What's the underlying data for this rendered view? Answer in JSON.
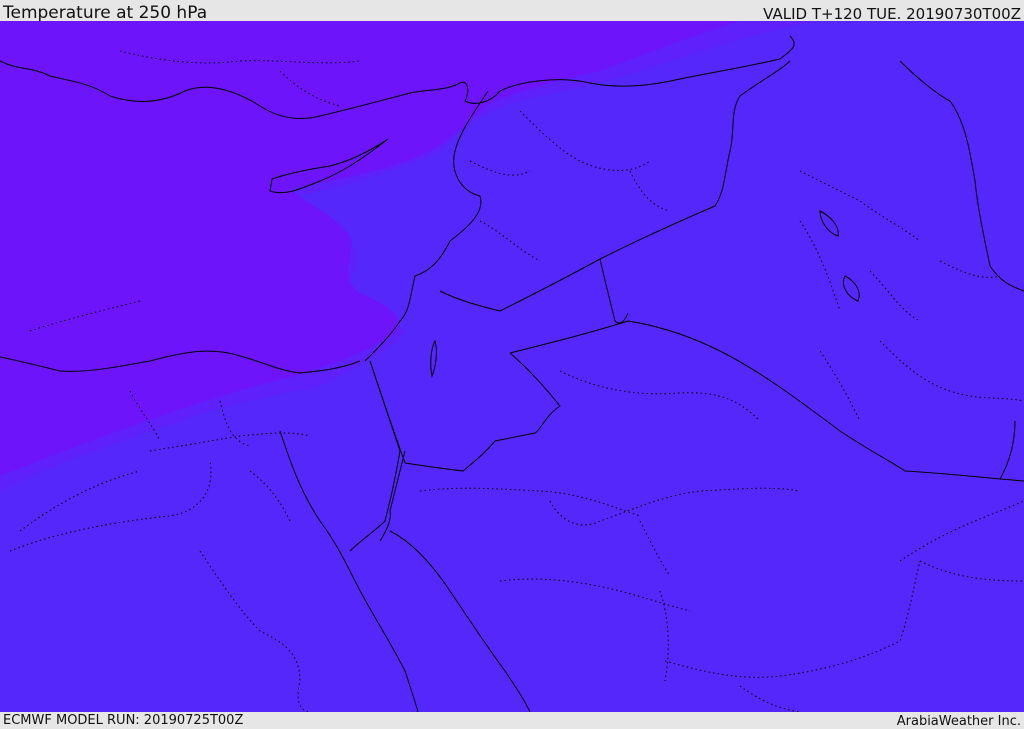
{
  "header": {
    "title": "Temperature at 250 hPa",
    "valid_time": "VALID T+120 TUE. 20190730T00Z"
  },
  "footer": {
    "model_run": "ECMWF MODEL RUN: 20190725T00Z",
    "credit": "ArabiaWeather Inc."
  },
  "colors": {
    "background_bar": "#e6e6e6",
    "warm_zone": "#5627fb",
    "cool_zone": "#6d14fb",
    "transition_zone": "#5e20fb",
    "coastline": "#000000",
    "border": "#000000"
  }
}
